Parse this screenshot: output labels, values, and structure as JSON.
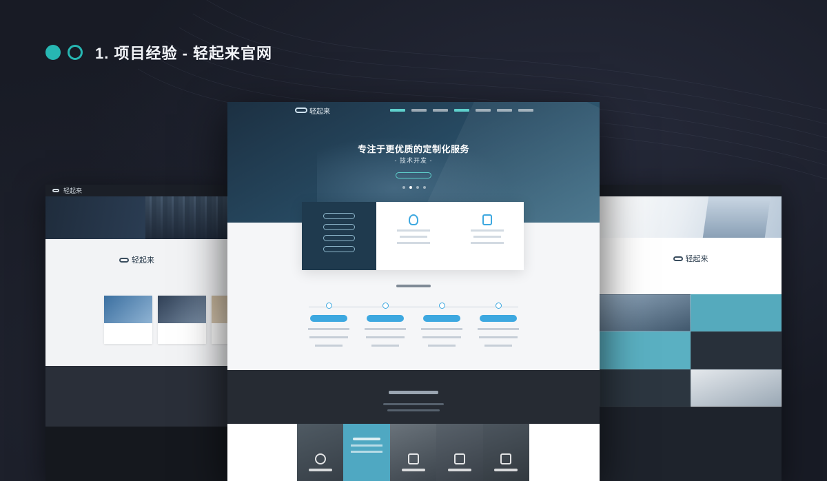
{
  "heading": {
    "title": "1. 项目经验 - 轻起来官网"
  },
  "center": {
    "brand": "轻起来",
    "hero_title": "专注于更优质的定制化服务",
    "hero_subtitle": "- 技术开发 -"
  },
  "left": {
    "brand": "轻起来"
  },
  "right": {
    "brand": "轻起来"
  },
  "colors": {
    "accent": "#27b7b3",
    "background": "#181b25",
    "hero_blue": "#274a62",
    "highlight_blue": "#3da8e0",
    "tile_teal": "#4fa8c2"
  }
}
